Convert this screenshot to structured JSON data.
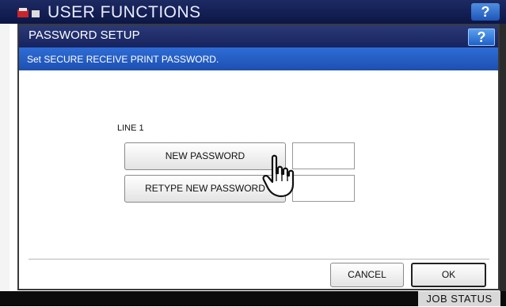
{
  "background": {
    "title": "USER FUNCTIONS",
    "help_label": "?",
    "job_status_label": "JOB STATUS"
  },
  "dialog": {
    "title": "PASSWORD SETUP",
    "help_label": "?",
    "instruction": "Set SECURE RECEIVE PRINT PASSWORD.",
    "line_label": "LINE 1",
    "new_password_label": "NEW PASSWORD",
    "new_password_value": "",
    "retype_password_label": "RETYPE NEW PASSWORD",
    "retype_password_value": "",
    "cancel_label": "CANCEL",
    "ok_label": "OK"
  },
  "colors": {
    "title_bar": "#16235e",
    "instruction_bar": "#2e6dd6",
    "help_button": "#2060c8"
  }
}
